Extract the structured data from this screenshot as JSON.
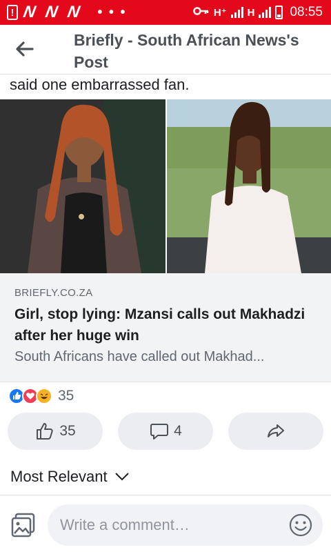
{
  "status_bar": {
    "carrier_glyphs": "N N N",
    "dots": "• • •",
    "network_1": "H⁺",
    "network_2": "H",
    "time": "08:55",
    "bar_color": "#e4081b"
  },
  "header": {
    "title": "Briefly - South African News's Post"
  },
  "post": {
    "text": "said one embarrassed fan."
  },
  "link_card": {
    "domain": "BRIEFLY.CO.ZA",
    "title": "Girl, stop lying: Mzansi calls out Makhadzi after her huge win",
    "description": "South Africans have called out Makhad..."
  },
  "reactions": {
    "icons": [
      "like-icon",
      "love-icon",
      "haha-icon"
    ],
    "count": "35"
  },
  "actions": {
    "like_count": "35",
    "comment_count": "4"
  },
  "comments": {
    "sort_label": "Most Relevant",
    "placeholder": "Write a comment…"
  },
  "colors": {
    "like": "#1877f2",
    "love": "#f33e58",
    "haha": "#f7b125"
  }
}
